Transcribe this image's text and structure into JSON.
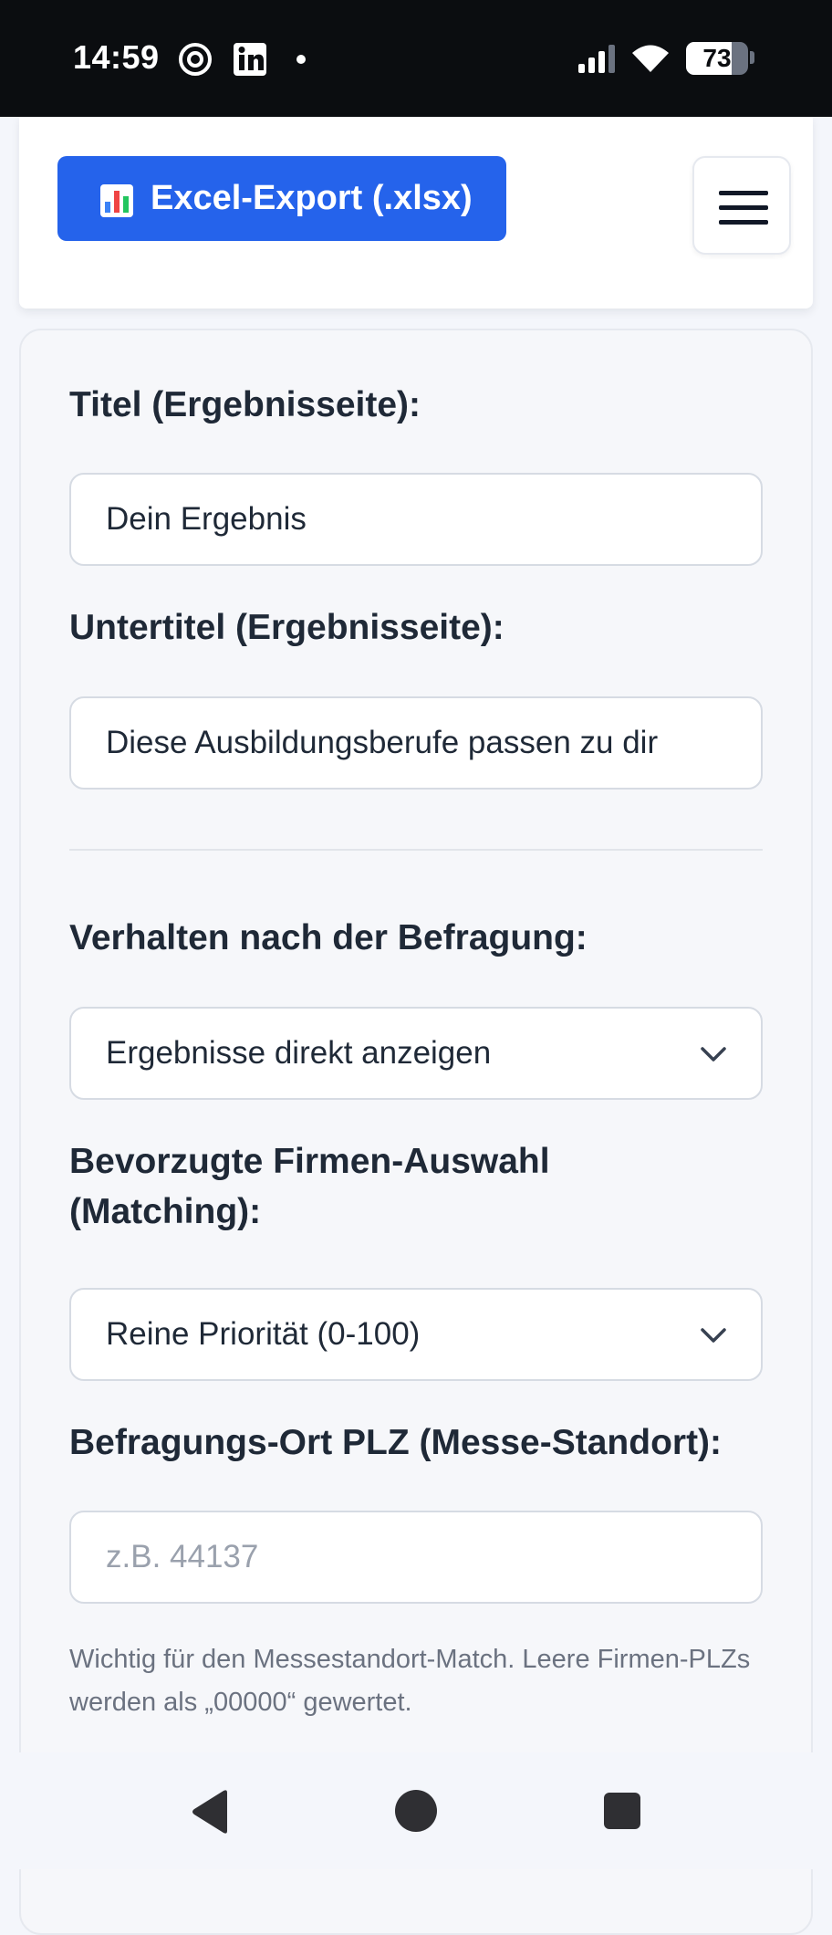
{
  "status_bar": {
    "time": "14:59",
    "battery": "73",
    "icons": [
      "threads-icon",
      "linkedin-icon",
      "notification-dot-icon",
      "signal-icon",
      "wifi-icon",
      "battery-icon"
    ]
  },
  "toolbar": {
    "export_label": "Excel-Export (.xlsx)",
    "export_icon": "bar-chart-icon",
    "menu_icon": "hamburger-menu-icon"
  },
  "form": {
    "title_label": "Titel (Ergebnisseite):",
    "title_value": "Dein Ergebnis",
    "subtitle_label": "Untertitel (Ergebnisseite):",
    "subtitle_value": "Diese Ausbildungsberufe passen zu dir",
    "behavior_label": "Verhalten nach der Befragung:",
    "behavior_value": "Ergebnisse direkt anzeigen",
    "matching_label_line1": "Bevorzugte Firmen-Auswahl",
    "matching_label_line2": "(Matching):",
    "matching_value": "Reine Priorität (0-100)",
    "plz_label": "Befragungs-Ort PLZ (Messe-Standort):",
    "plz_value": "",
    "plz_placeholder": "z.B. 44137",
    "plz_help": "Wichtig für den Messestandort-Match. Leere Firmen-PLZs werden als „00000“ gewertet."
  },
  "nav": {
    "icons": [
      "back-icon",
      "home-icon",
      "recents-icon"
    ]
  },
  "colors": {
    "accent": "#2563eb",
    "status_bar": "#0b0d10",
    "text": "#1f2937",
    "muted": "#6b7280"
  }
}
